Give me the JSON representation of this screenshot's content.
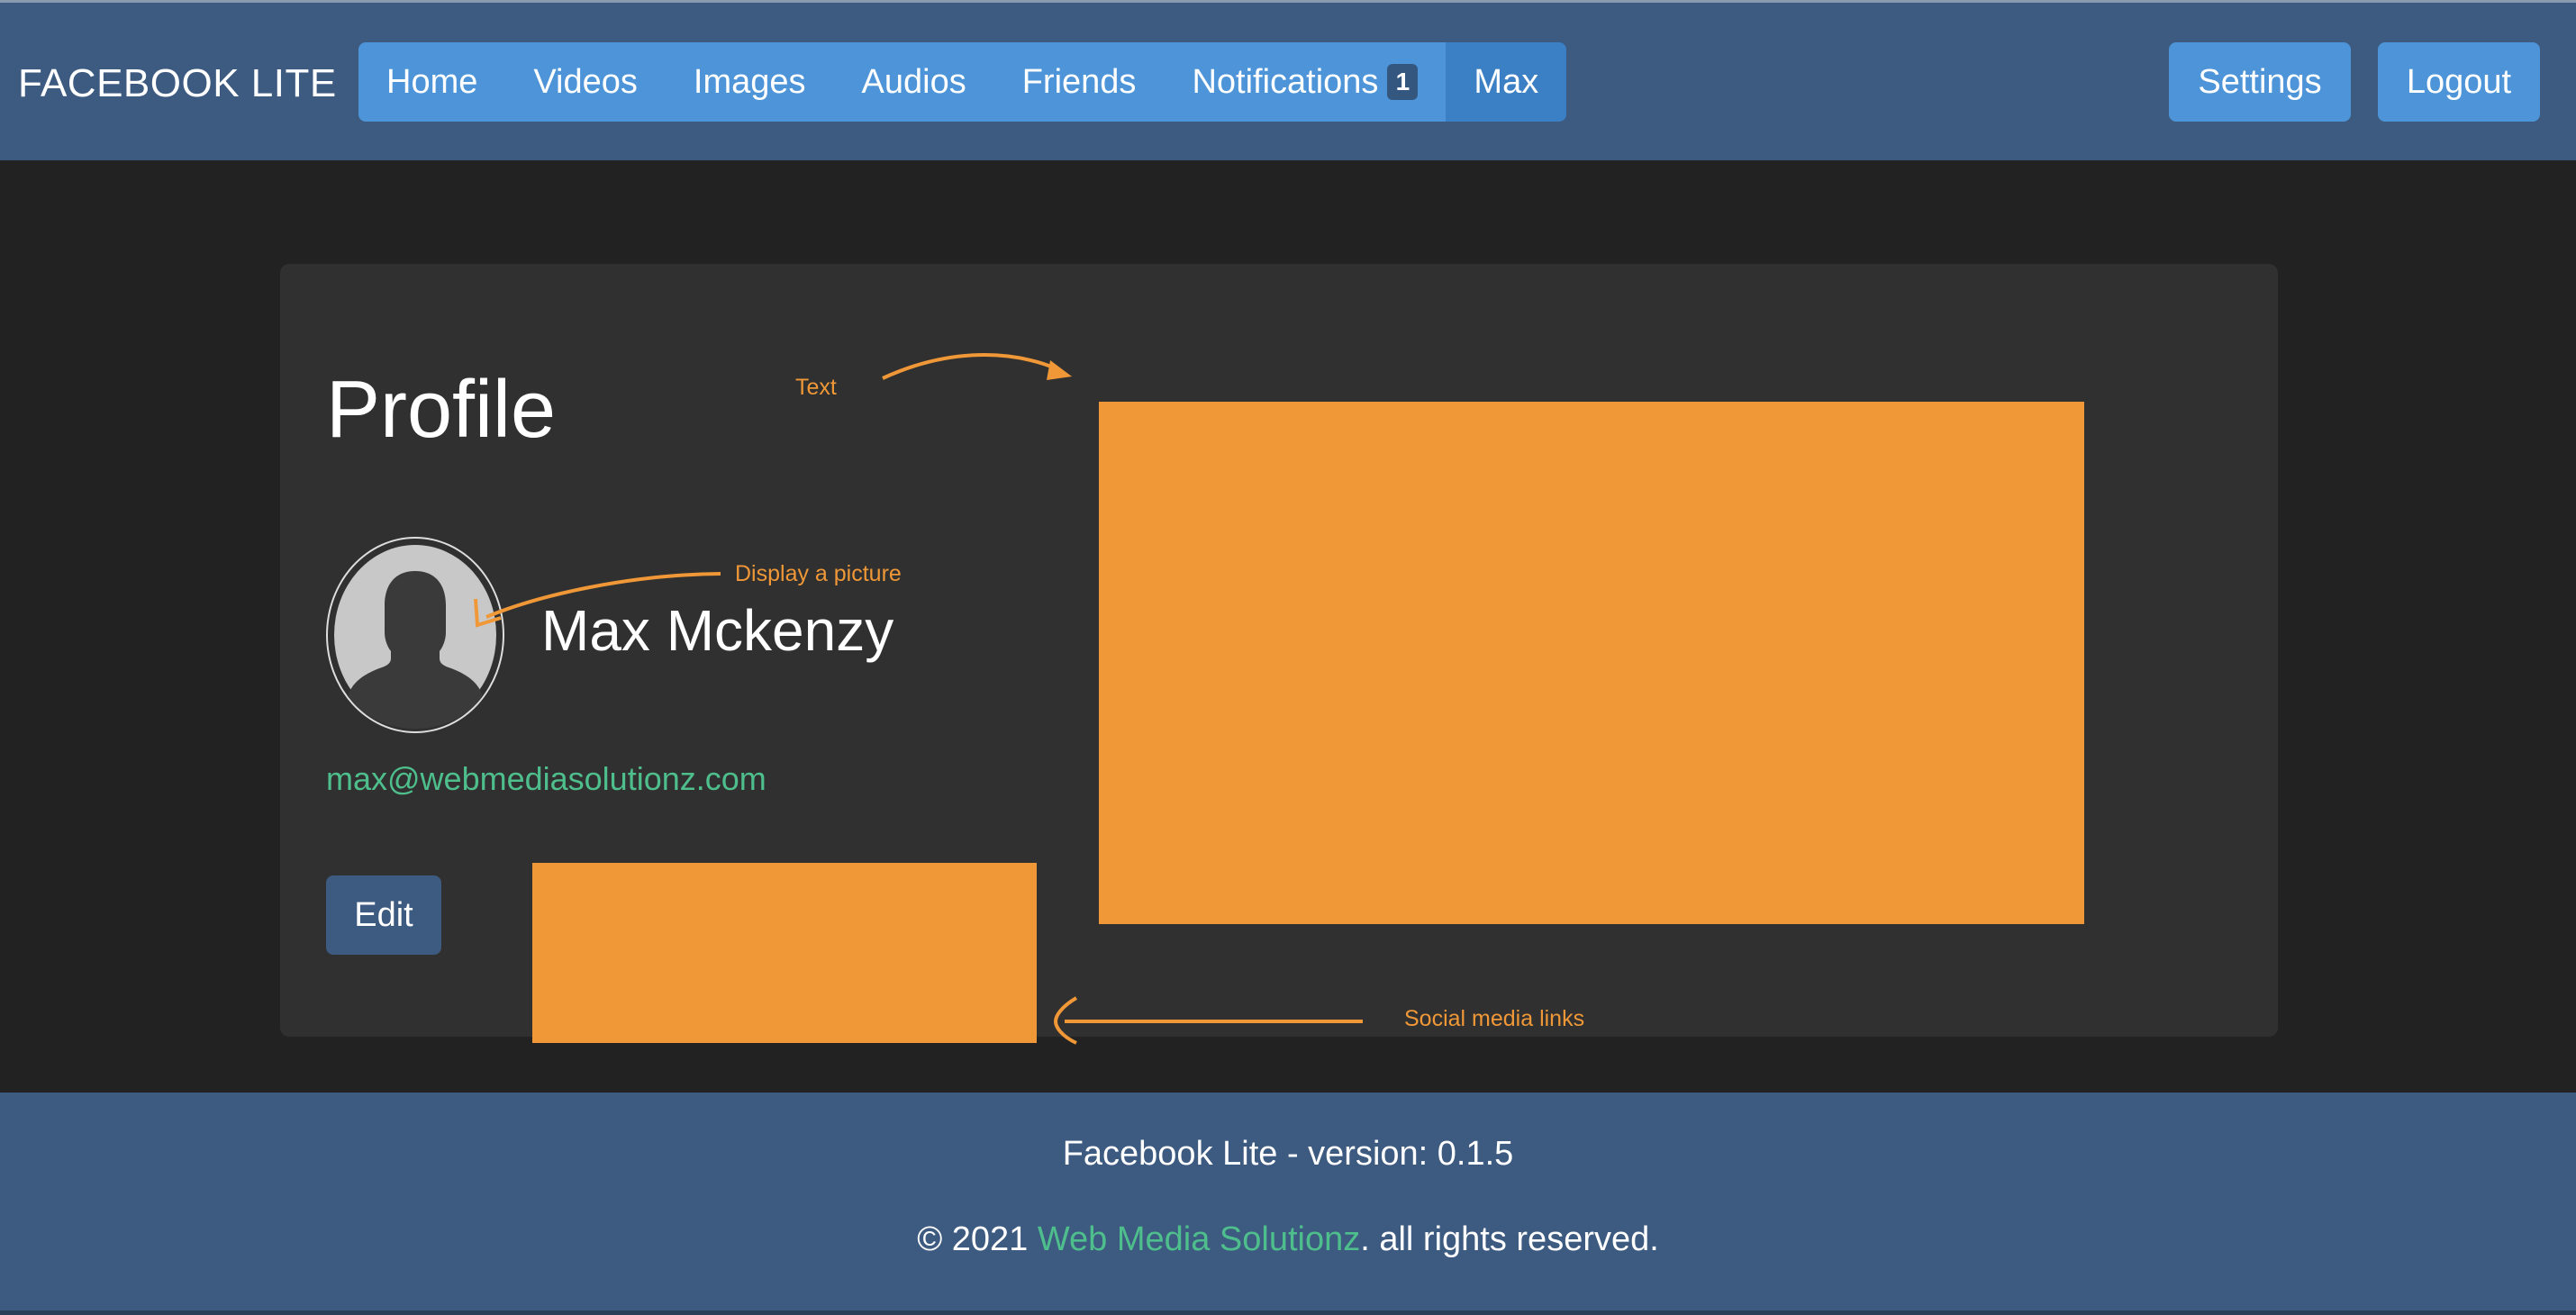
{
  "navbar": {
    "brand": "FACEBOOK LITE",
    "items": [
      {
        "label": "Home"
      },
      {
        "label": "Videos"
      },
      {
        "label": "Images"
      },
      {
        "label": "Audios"
      },
      {
        "label": "Friends"
      },
      {
        "label": "Notifications",
        "badge": "1"
      },
      {
        "label": "Max"
      }
    ],
    "settings_label": "Settings",
    "logout_label": "Logout"
  },
  "profile": {
    "title": "Profile",
    "name": "Max Mckenzy",
    "email": "max@webmediasolutionz.com",
    "edit_label": "Edit"
  },
  "annotations": {
    "text": "Text",
    "picture": "Display a picture",
    "social": "Social media links",
    "color": "#f09837"
  },
  "footer": {
    "version": "Facebook Lite - version: 0.1.5",
    "copyright_prefix": "© 2021 ",
    "company": "Web Media Solutionz",
    "copyright_suffix": ". all rights reserved."
  },
  "colors": {
    "navbar": "#3d5a80",
    "nav_button": "#4d94d8",
    "background": "#222222",
    "card": "#303030",
    "accent_green": "#4ebf8c",
    "placeholder_orange": "#f09837"
  }
}
